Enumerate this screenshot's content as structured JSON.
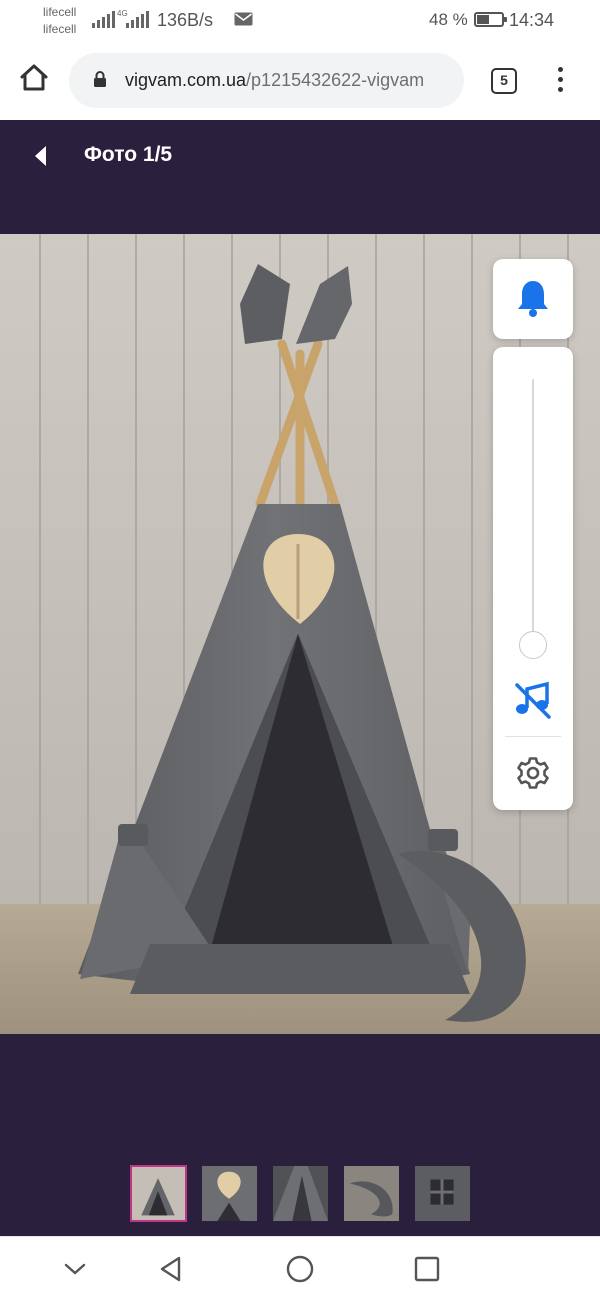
{
  "status_bar": {
    "carrier_1": "lifecell",
    "carrier_2": "lifecell",
    "network_tag": "4G",
    "speed": "136B/s",
    "battery_percent": "48 %",
    "battery_level": 0.48,
    "time": "14:34",
    "notification_icon": "mail-icon"
  },
  "browser": {
    "url_host": "vigvam.com.ua",
    "url_path": "/p1215432622-vigvam",
    "tab_count": "5",
    "icons": [
      "home-icon",
      "lock-icon",
      "tabs-icon",
      "menu-dots-icon"
    ]
  },
  "gallery": {
    "title": "Фото 1/5",
    "back_icon": "chevron-left-icon",
    "background_color": "#2a1f3d",
    "active_thumb_color": "#c13584",
    "thumbnails": [
      {
        "subject": "teepee-full",
        "active": true
      },
      {
        "subject": "leaf-ornament",
        "active": false
      },
      {
        "subject": "tent-detail",
        "active": false
      },
      {
        "subject": "moon-pillow",
        "active": false
      },
      {
        "subject": "tent-window",
        "active": false
      }
    ]
  },
  "volume_widget": {
    "bell_icon": "bell-icon",
    "music_icon": "music-off-icon",
    "settings_icon": "gear-icon",
    "volume_level": 0.0,
    "accent_color": "#1a73e8"
  },
  "nav_bar": {
    "icons": [
      "chevron-down-icon",
      "back-triangle-icon",
      "home-circle-icon",
      "recents-square-icon"
    ]
  }
}
